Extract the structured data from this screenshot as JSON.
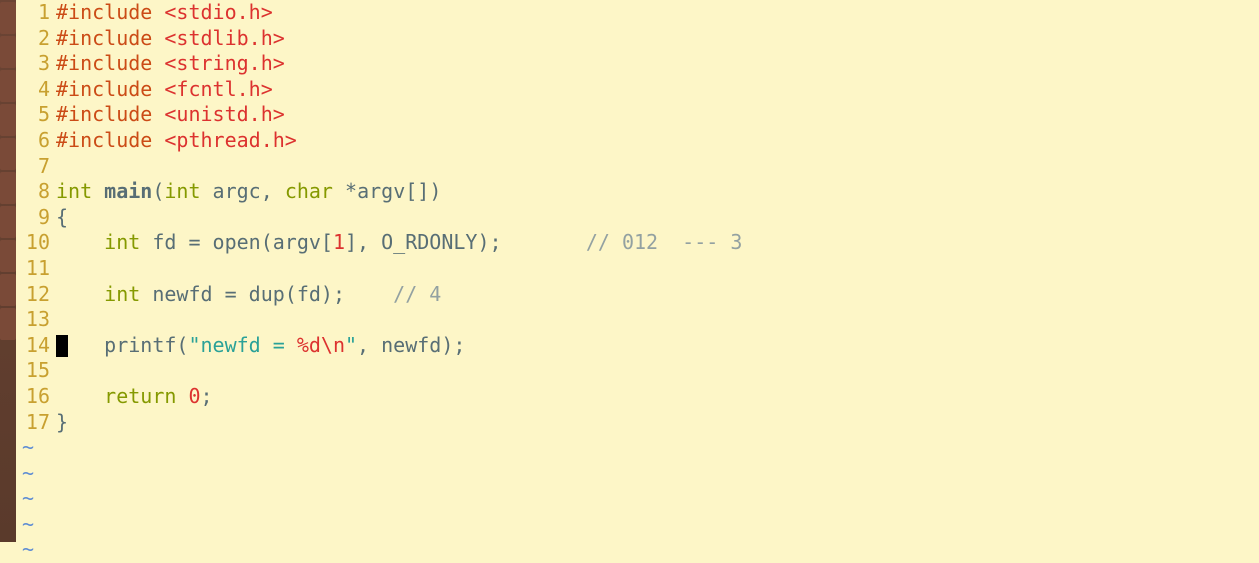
{
  "launcher": {
    "items": 10
  },
  "lines": [
    {
      "n": "1",
      "seg": [
        {
          "c": "pp",
          "t": "#include "
        },
        {
          "c": "inc",
          "t": "<stdio.h>"
        }
      ]
    },
    {
      "n": "2",
      "seg": [
        {
          "c": "pp",
          "t": "#include "
        },
        {
          "c": "inc",
          "t": "<stdlib.h>"
        }
      ]
    },
    {
      "n": "3",
      "seg": [
        {
          "c": "pp",
          "t": "#include "
        },
        {
          "c": "inc",
          "t": "<string.h>"
        }
      ]
    },
    {
      "n": "4",
      "seg": [
        {
          "c": "pp",
          "t": "#include "
        },
        {
          "c": "inc",
          "t": "<fcntl.h>"
        }
      ]
    },
    {
      "n": "5",
      "seg": [
        {
          "c": "pp",
          "t": "#include "
        },
        {
          "c": "inc",
          "t": "<unistd.h>"
        }
      ]
    },
    {
      "n": "6",
      "seg": [
        {
          "c": "pp",
          "t": "#include "
        },
        {
          "c": "inc",
          "t": "<pthread.h>"
        }
      ]
    },
    {
      "n": "7",
      "seg": []
    },
    {
      "n": "8",
      "seg": [
        {
          "c": "kw",
          "t": "int"
        },
        {
          "c": "ident",
          "t": " "
        },
        {
          "c": "mainfn",
          "t": "main"
        },
        {
          "c": "ident",
          "t": "("
        },
        {
          "c": "kw",
          "t": "int"
        },
        {
          "c": "ident",
          "t": " argc, "
        },
        {
          "c": "kw",
          "t": "char"
        },
        {
          "c": "ident",
          "t": " *argv[])"
        }
      ]
    },
    {
      "n": "9",
      "seg": [
        {
          "c": "ident",
          "t": "{"
        }
      ]
    },
    {
      "n": "10",
      "seg": [
        {
          "c": "ident",
          "t": "    "
        },
        {
          "c": "kw",
          "t": "int"
        },
        {
          "c": "ident",
          "t": " fd = open(argv["
        },
        {
          "c": "num",
          "t": "1"
        },
        {
          "c": "ident",
          "t": "], O_RDONLY);       "
        },
        {
          "c": "cm",
          "t": "// 012  --- 3"
        }
      ]
    },
    {
      "n": "11",
      "seg": []
    },
    {
      "n": "12",
      "seg": [
        {
          "c": "ident",
          "t": "    "
        },
        {
          "c": "kw",
          "t": "int"
        },
        {
          "c": "ident",
          "t": " newfd = dup(fd);    "
        },
        {
          "c": "cm",
          "t": "// 4"
        }
      ]
    },
    {
      "n": "13",
      "seg": []
    },
    {
      "n": "14",
      "cursor": true,
      "seg": [
        {
          "c": "ident",
          "t": "    printf("
        },
        {
          "c": "str",
          "t": "\"newfd = "
        },
        {
          "c": "strfmt",
          "t": "%d\\n"
        },
        {
          "c": "str",
          "t": "\""
        },
        {
          "c": "ident",
          "t": ", newfd);"
        }
      ]
    },
    {
      "n": "15",
      "seg": []
    },
    {
      "n": "16",
      "seg": [
        {
          "c": "ident",
          "t": "    "
        },
        {
          "c": "kw",
          "t": "return"
        },
        {
          "c": "ident",
          "t": " "
        },
        {
          "c": "num",
          "t": "0"
        },
        {
          "c": "ident",
          "t": ";"
        }
      ]
    },
    {
      "n": "17",
      "seg": [
        {
          "c": "ident",
          "t": "}"
        }
      ]
    }
  ],
  "tildes": 5,
  "tilde_char": "~"
}
